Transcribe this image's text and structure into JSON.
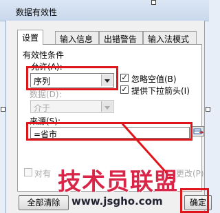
{
  "window": {
    "title": "数据有效性"
  },
  "tabs": [
    {
      "label": "设置",
      "active": true
    },
    {
      "label": "输入信息",
      "active": false
    },
    {
      "label": "出错警告",
      "active": false
    },
    {
      "label": "输入法模式",
      "active": false
    }
  ],
  "section": {
    "title": "有效性条件"
  },
  "allow": {
    "label": "允许(A):",
    "value": "序列"
  },
  "data": {
    "label": "数据(D):",
    "value": "介于"
  },
  "ignore_blank": {
    "label": "忽略空值(B)",
    "checked": true
  },
  "dropdown_arrow": {
    "label": "提供下拉箭头(I)",
    "checked": true
  },
  "source": {
    "label": "来源(S):",
    "value": "=省市"
  },
  "apply_changes": {
    "label_start": "对有",
    "label_end": "更改(P)",
    "checked": false
  },
  "buttons": {
    "clear_all": "全部清除",
    "ok": "确定"
  },
  "watermark": {
    "text": "技术员联盟",
    "url": "www.jsgho.com"
  },
  "colors": {
    "highlight": "#e0141b",
    "watermark": "#d20028"
  }
}
